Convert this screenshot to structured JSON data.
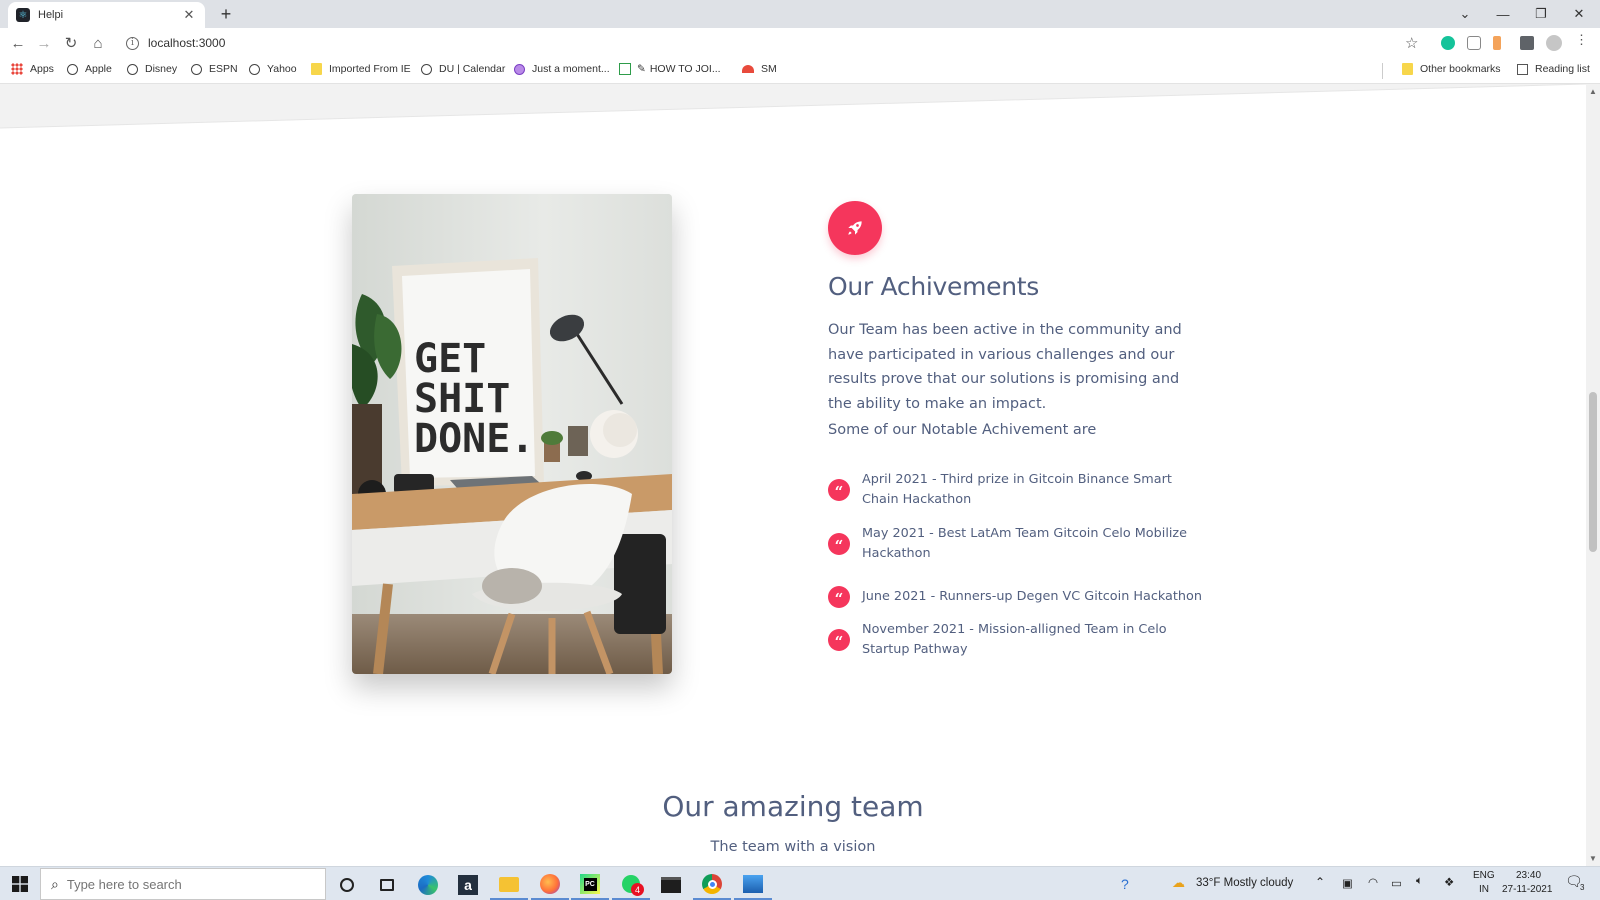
{
  "browser": {
    "tab_title": "Helpi",
    "url": "localhost:3000",
    "bookmarks": [
      "Apps",
      "Apple",
      "Disney",
      "ESPN",
      "Yahoo",
      "Imported From IE",
      "DU | Calendar",
      "Just a moment...",
      "HOW TO JOI...",
      "SM"
    ],
    "other_bookmarks": "Other bookmarks",
    "reading_list": "Reading list"
  },
  "achievements": {
    "title": "Our Achivements",
    "description": "Our Team has been active in the community and have participated in various challenges and our results prove that our solutions is promising and the ability to make an impact.",
    "subtitle": "Some of our Notable Achivement are",
    "items": [
      "April 2021 - Third prize in Gitcoin Binance Smart Chain Hackathon",
      "May 2021 - Best LatAm Team Gitcoin Celo Mobilize Hackathon",
      "June 2021 - Runners-up Degen VC Gitcoin Hackathon",
      "November 2021 - Mission-alligned Team in Celo Startup Pathway"
    ],
    "poster_text": [
      "GET",
      "SHIT",
      "DONE."
    ]
  },
  "team": {
    "title": "Our amazing team",
    "subtitle": "The team with a vision"
  },
  "taskbar": {
    "search_placeholder": "Type here to search",
    "badge_count": "4",
    "weather": "33°F  Mostly cloudy",
    "lang_line1": "ENG",
    "lang_line2": "IN",
    "time": "23:40",
    "date": "27-11-2021",
    "notifications": "3"
  },
  "colors": {
    "accent": "#f5365c",
    "text": "#525f7f"
  }
}
